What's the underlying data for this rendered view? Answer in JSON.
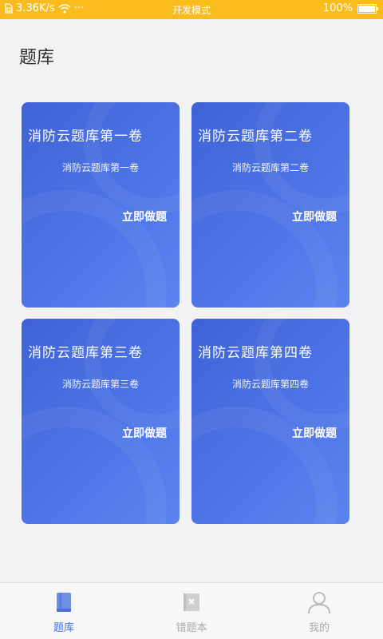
{
  "status_bar": {
    "network_speed": "3.36K/s",
    "dots": "···",
    "mode": "开发模式",
    "battery": "100%",
    "battery_level": 1.0,
    "background_color": "#f9bc1c"
  },
  "page": {
    "title": "题库"
  },
  "cards": [
    {
      "title": "消防云题库第一卷",
      "subtitle": "消防云题库第一卷",
      "action": "立即做题"
    },
    {
      "title": "消防云题库第二卷",
      "subtitle": "消防云题库第二卷",
      "action": "立即做题"
    },
    {
      "title": "消防云题库第三卷",
      "subtitle": "消防云题库第三卷",
      "action": "立即做题"
    },
    {
      "title": "消防云题库第四卷",
      "subtitle": "消防云题库第四卷",
      "action": "立即做题"
    }
  ],
  "tabbar": {
    "tabs": [
      {
        "label": "题库",
        "icon": "book-icon",
        "active": true
      },
      {
        "label": "错题本",
        "icon": "wrong-book-icon",
        "active": false
      },
      {
        "label": "我的",
        "icon": "user-icon",
        "active": false
      }
    ],
    "active_color": "#4a6fd8"
  },
  "colors": {
    "card_gradient_start": "#3f63d6",
    "card_gradient_end": "#5b84f0",
    "background": "#f2f1f3"
  }
}
